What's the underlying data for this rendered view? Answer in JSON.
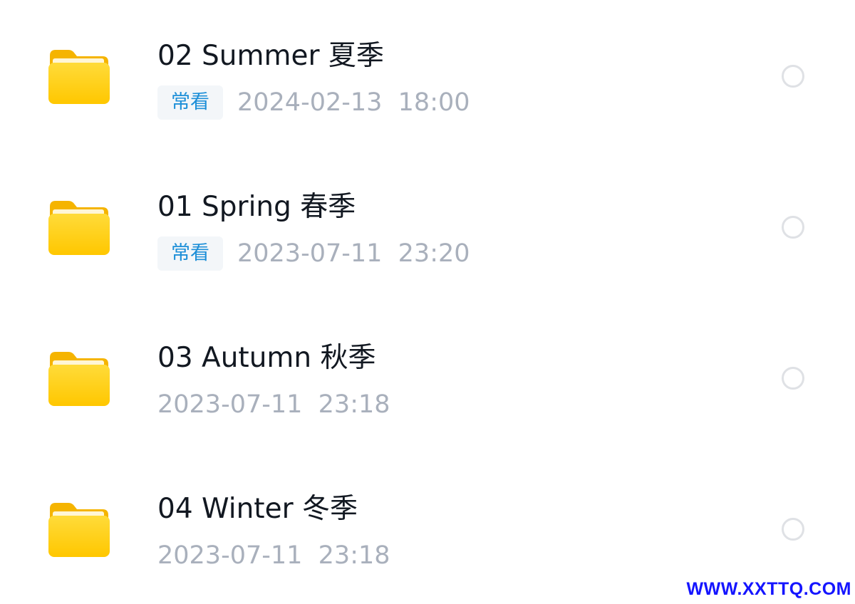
{
  "folders": [
    {
      "icon": "folder-icon",
      "name": "02 Summer 夏季",
      "tag": "常看",
      "date": "2024-02-13  18:00"
    },
    {
      "icon": "folder-icon",
      "name": "01 Spring 春季",
      "tag": "常看",
      "date": "2023-07-11  23:20"
    },
    {
      "icon": "folder-icon",
      "name": "03 Autumn 秋季",
      "tag": "",
      "date": "2023-07-11  23:18"
    },
    {
      "icon": "folder-icon",
      "name": "04 Winter 冬季",
      "tag": "",
      "date": "2023-07-11  23:18"
    }
  ],
  "colors": {
    "folder_body": "#ffcf1a",
    "folder_back": "#f5b400",
    "tag_text": "#1d8fd8",
    "date_text": "#a9b0bc",
    "watermark": "#1515ff"
  },
  "watermark": "WWW.XXTTQ.COM"
}
